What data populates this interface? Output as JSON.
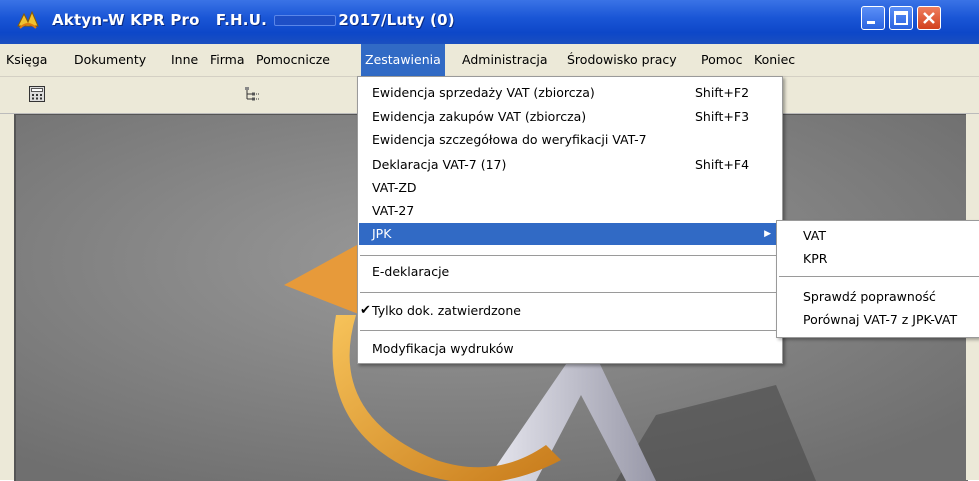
{
  "window": {
    "title_app": "Aktyn-W KPR Pro",
    "title_firm": "F.H.U.",
    "title_period": "2017/Luty (0)",
    "minimize_icon": "minimize-icon",
    "maximize_icon": "maximize-icon",
    "close_icon": "close-icon"
  },
  "menubar": {
    "items": [
      {
        "label": "Księga"
      },
      {
        "label": "Dokumenty"
      },
      {
        "label": "Inne"
      },
      {
        "label": "Firma"
      },
      {
        "label": "Pomocnicze"
      },
      {
        "label": "Zestawienia",
        "active": true
      },
      {
        "label": "Administracja"
      },
      {
        "label": "Środowisko pracy"
      },
      {
        "label": "Pomoc"
      },
      {
        "label": "Koniec"
      }
    ]
  },
  "toolbar": {
    "icons": [
      "calculator-icon",
      "tree-list-icon"
    ]
  },
  "dropdown": {
    "items": [
      {
        "label": "Ewidencja sprzedaży VAT (zbiorcza)",
        "shortcut": "Shift+F2"
      },
      {
        "label": "Ewidencja zakupów VAT (zbiorcza)",
        "shortcut": "Shift+F3"
      },
      {
        "label": "Ewidencja szczegółowa do weryfikacji VAT-7",
        "shortcut": ""
      },
      {
        "label": "Deklaracja VAT-7 (17)",
        "shortcut": "Shift+F4"
      },
      {
        "label": "VAT-ZD",
        "shortcut": ""
      },
      {
        "label": "VAT-27",
        "shortcut": ""
      },
      {
        "label": "JPK",
        "shortcut": "",
        "submenu": true,
        "selected": true
      },
      {
        "label": "E-deklaracje",
        "shortcut": ""
      },
      {
        "label": "Tylko dok. zatwierdzone",
        "shortcut": "",
        "checked": true
      },
      {
        "label": "Modyfikacja wydruków",
        "shortcut": ""
      }
    ]
  },
  "submenu": {
    "items": [
      {
        "label": "VAT"
      },
      {
        "label": "KPR"
      },
      {
        "label": "Sprawdź poprawność"
      },
      {
        "label": "Porównaj VAT-7 z JPK-VAT"
      }
    ]
  },
  "colors": {
    "titlebar": "#0d47c8",
    "menu_highlight": "#316ac5",
    "chrome": "#ece9d8",
    "client_bg": "#7f7f7f"
  }
}
